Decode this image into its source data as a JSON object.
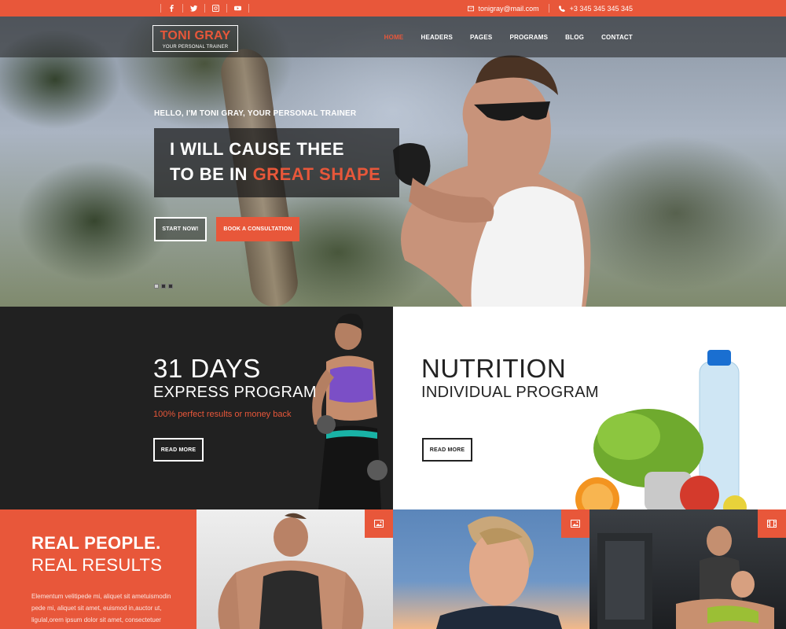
{
  "topbar": {
    "email": "tonigray@mail.com",
    "phone": "+3 345 345 345 345",
    "social_icons": [
      "facebook-icon",
      "twitter-icon",
      "instagram-icon",
      "youtube-icon"
    ]
  },
  "brand": {
    "name": "TONI GRAY",
    "tagline": "YOUR PERSONAL TRAINER"
  },
  "nav": {
    "items": [
      {
        "label": "HOME",
        "active": true
      },
      {
        "label": "HEADERS",
        "active": false
      },
      {
        "label": "PAGES",
        "active": false
      },
      {
        "label": "PROGRAMS",
        "active": false
      },
      {
        "label": "BLOG",
        "active": false
      },
      {
        "label": "CONTACT",
        "active": false
      }
    ]
  },
  "hero": {
    "subtitle": "HELLO, I'M TONI GRAY, YOUR PERSONAL TRAINER",
    "headline_line1": "I WILL CAUSE THEE",
    "headline_line2_prefix": "TO BE IN ",
    "headline_line2_accent": "GREAT SHAPE",
    "start_button": "START NOW!",
    "book_button": "BOOK A CONSULTATION",
    "slide_count": 3,
    "active_slide": 1
  },
  "programs": {
    "express": {
      "title": "31 DAYS",
      "subtitle": "EXPRESS PROGRAM",
      "note": "100% perfect results or money back",
      "button": "READ MORE"
    },
    "nutrition": {
      "title": "NUTRITION",
      "subtitle": "INDIVIDUAL PROGRAM",
      "button": "READ MORE"
    }
  },
  "results": {
    "line1": "REAL PEOPLE.",
    "line2": "REAL RESULTS",
    "body": "Elementum velitipede mi, aliquet sit ametuismodin pede mi, aliquet sit amet, euismod in,auctor ut, ligulal,orem ipsum dolor sit amet, consectetuer"
  },
  "gallery": [
    {
      "badge_icon": "image-icon"
    },
    {
      "badge_icon": "image-icon"
    },
    {
      "badge_icon": "film-icon"
    }
  ],
  "colors": {
    "accent": "#e8573a",
    "dark": "#212121"
  }
}
